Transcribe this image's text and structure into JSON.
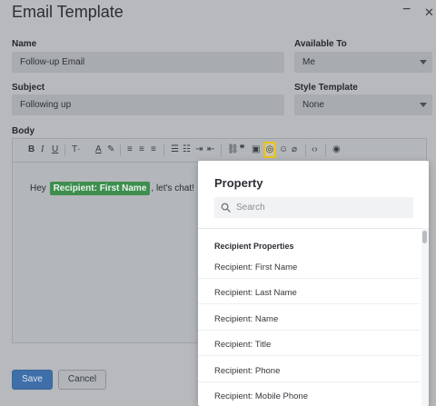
{
  "dialog": {
    "title": "Email Template",
    "minimize_glyph": "−",
    "close_glyph": "✕"
  },
  "form": {
    "name": {
      "label": "Name",
      "value": "Follow-up Email"
    },
    "available_to": {
      "label": "Available To",
      "value": "Me"
    },
    "subject": {
      "label": "Subject",
      "value": "Following up"
    },
    "style_template": {
      "label": "Style Template",
      "value": "None"
    },
    "body_label": "Body"
  },
  "toolbar": {
    "bold": "B",
    "italic": "I",
    "underline": "U",
    "text_size": "T·",
    "text_color": "A",
    "highlight": "✎",
    "align_left": "≡",
    "align_center": "≡",
    "align_right": "≡",
    "bullets": "☰",
    "numbers": "☷",
    "indent": "⇥",
    "outdent": "⇤",
    "link": "⛓",
    "quote": "❞",
    "image": "▣",
    "property": "◎",
    "emoji": "☺",
    "attach": "⌀",
    "code": "‹›",
    "preview": "◉"
  },
  "editor": {
    "text_before": "Hey",
    "token": "Recipient: First Name",
    "text_after": ", let's chat!"
  },
  "buttons": {
    "save": "Save",
    "cancel": "Cancel"
  },
  "popover": {
    "title": "Property",
    "search_placeholder": "Search",
    "section": "Recipient Properties",
    "items": [
      "Recipient: First Name",
      "Recipient: Last Name",
      "Recipient: Name",
      "Recipient: Title",
      "Recipient: Phone",
      "Recipient: Mobile Phone"
    ]
  },
  "colors": {
    "token_bg": "#3e8e4f",
    "save_bg": "#3f6fa8",
    "active_tool_border": "#e8c21c"
  }
}
